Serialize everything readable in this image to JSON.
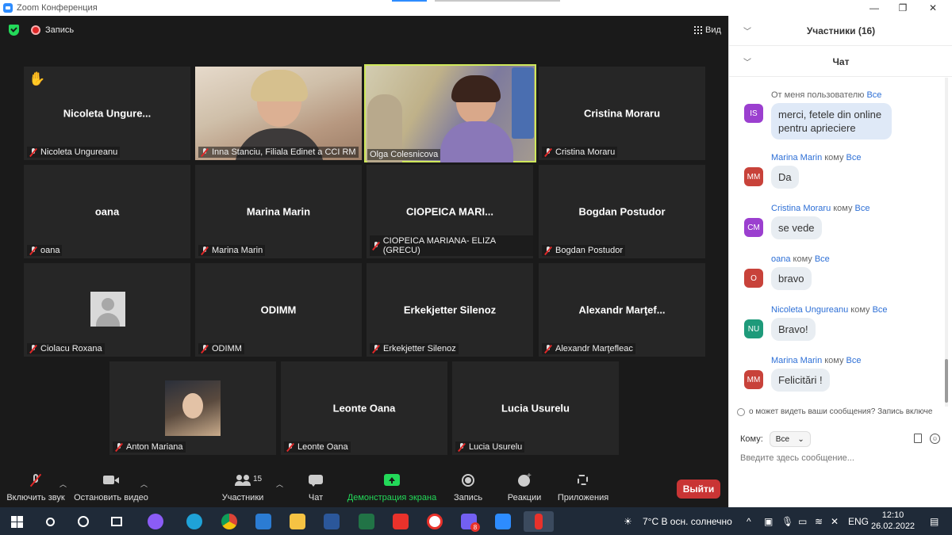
{
  "window": {
    "title": "Zoom Конференция",
    "minimize": "—",
    "maximize": "❐",
    "close": "✕"
  },
  "topbar": {
    "recording_label": "Запись",
    "view_label": "Вид"
  },
  "tiles": [
    {
      "center": "Nicoleta  Ungure...",
      "label": "Nicoleta Ungureanu"
    },
    {
      "center": "",
      "label": "Inna Stanciu, Filiala Edinet a CCI RM"
    },
    {
      "center": "",
      "label": "Olga Colesnicova"
    },
    {
      "center": "Cristina Moraru",
      "label": "Cristina Moraru"
    },
    {
      "center": "oana",
      "label": "oana"
    },
    {
      "center": "Marina Marin",
      "label": "Marina Marin"
    },
    {
      "center": "CIOPEICA  MARI...",
      "label": "CIOPEICA MARIANA- ELIZA (GRECU)"
    },
    {
      "center": "Bogdan Postudor",
      "label": "Bogdan Postudor"
    },
    {
      "center": "",
      "label": "Ciolacu Roxana"
    },
    {
      "center": "ODIMM",
      "label": "ODIMM"
    },
    {
      "center": "Erkekjetter Silenoz",
      "label": "Erkekjetter Silenoz"
    },
    {
      "center": "Alexandr  Marţef...",
      "label": "Alexandr Marţefleac"
    },
    {
      "center": "",
      "label": "Anton Mariana"
    },
    {
      "center": "Leonte Oana",
      "label": "Leonte Oana"
    },
    {
      "center": "Lucia Usurelu",
      "label": "Lucia Usurelu"
    }
  ],
  "toolbar": {
    "unmute": "Включить звук",
    "stop_video": "Остановить видео",
    "participants": "Участники",
    "participants_count": "15",
    "chat": "Чат",
    "share_screen": "Демонстрация экрана",
    "record": "Запись",
    "reactions": "Реакции",
    "apps": "Приложения",
    "leave": "Выйти"
  },
  "panel": {
    "participants_header": "Участники (16)",
    "chat_header": "Чат",
    "messages": [
      {
        "meta_prefix": "От меня пользователю ",
        "to": "Все",
        "sender": "",
        "initials": "IS",
        "color": "#9b3fcf",
        "text": "merci, fetele din online pentru aprieciere"
      },
      {
        "meta_prefix": "",
        "sender": "Marina Marin",
        "to_word": " кому ",
        "to": "Все",
        "initials": "MM",
        "color": "#c8423a",
        "text": "Da"
      },
      {
        "meta_prefix": "",
        "sender": "Cristina Moraru",
        "to_word": " кому ",
        "to": "Все",
        "initials": "CM",
        "color": "#9b3fcf",
        "text": "se vede"
      },
      {
        "meta_prefix": "",
        "sender": "oana",
        "to_word": " кому ",
        "to": "Все",
        "initials": "O",
        "color": "#c8423a",
        "text": "bravo"
      },
      {
        "meta_prefix": "",
        "sender": "Nicoleta Ungureanu",
        "to_word": " кому ",
        "to": "Все",
        "initials": "NU",
        "color": "#1e9a7a",
        "text": "Bravo!"
      },
      {
        "meta_prefix": "",
        "sender": "Marina Marin",
        "to_word": " кому ",
        "to": "Все",
        "initials": "MM",
        "color": "#c8423a",
        "text": "Felicitări !"
      }
    ],
    "notice": "о может видеть ваши сообщения? Запись включе",
    "to_label": "Кому:",
    "to_value": "Все",
    "input_placeholder": "Введите здесь сообщение..."
  },
  "taskbar": {
    "weather": "7°C  В осн. солнечно",
    "lang": "ENG",
    "time": "12:10",
    "date": "26.02.2022",
    "mail_badge": "8"
  }
}
